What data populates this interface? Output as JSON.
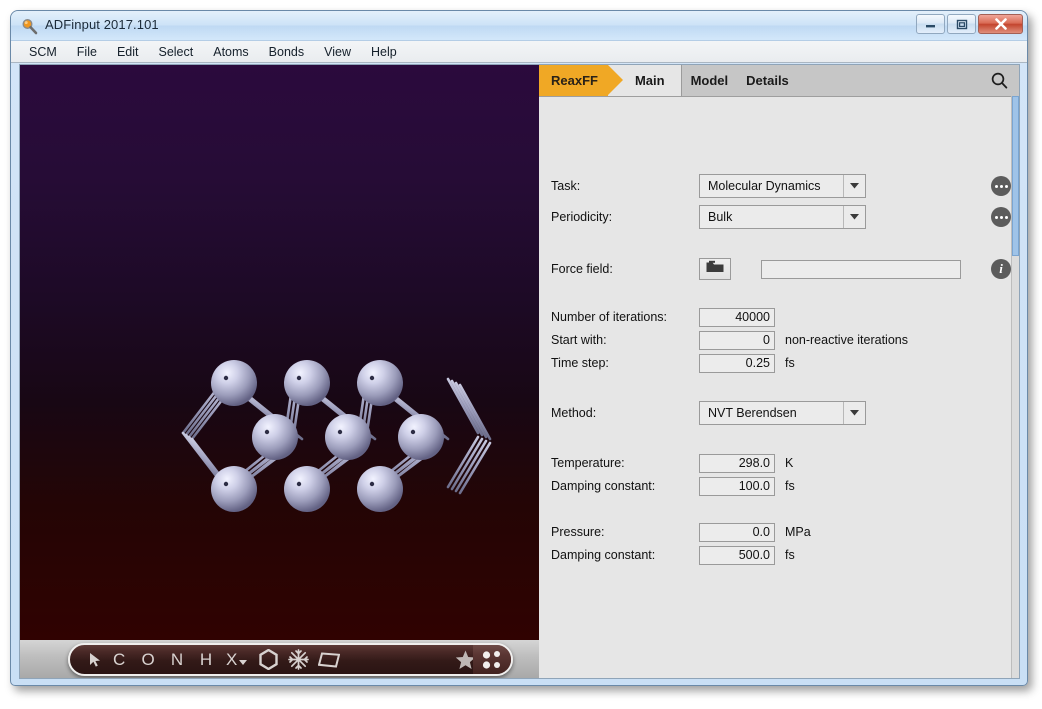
{
  "window": {
    "title": "ADFinput 2017.101",
    "icon": "magnifier-icon",
    "minimize_label": "Minimize",
    "maximize_label": "Maximize",
    "close_label": "Close"
  },
  "menubar": {
    "items": [
      {
        "label": "SCM"
      },
      {
        "label": "File"
      },
      {
        "label": "Edit"
      },
      {
        "label": "Select"
      },
      {
        "label": "Atoms"
      },
      {
        "label": "Bonds"
      },
      {
        "label": "View"
      },
      {
        "label": "Help"
      }
    ]
  },
  "tabs": {
    "module": "ReaxFF",
    "items": [
      {
        "label": "Main",
        "active": true
      },
      {
        "label": "Model",
        "active": false
      },
      {
        "label": "Details",
        "active": false
      }
    ],
    "search_icon": "search-icon"
  },
  "form": {
    "task": {
      "label": "Task:",
      "value": "Molecular Dynamics",
      "options": [
        "Molecular Dynamics"
      ],
      "more_icon": "ellipsis-icon"
    },
    "periodicity": {
      "label": "Periodicity:",
      "value": "Bulk",
      "options": [
        "Bulk"
      ],
      "more_icon": "ellipsis-icon"
    },
    "force_field": {
      "label": "Force field:",
      "value": "",
      "browse_icon": "folder-icon",
      "info_icon": "info-icon"
    },
    "iterations": {
      "label": "Number of iterations:",
      "value": "40000",
      "unit": ""
    },
    "start_with": {
      "label": "Start with:",
      "value": "0",
      "unit": "non-reactive iterations"
    },
    "time_step": {
      "label": "Time step:",
      "value": "0.25",
      "unit": "fs"
    },
    "method": {
      "label": "Method:",
      "value": "NVT Berendsen",
      "options": [
        "NVT Berendsen"
      ]
    },
    "temperature": {
      "label": "Temperature:",
      "value": "298.0",
      "unit": "K"
    },
    "temp_damping": {
      "label": "Damping constant:",
      "value": "100.0",
      "unit": "fs"
    },
    "pressure": {
      "label": "Pressure:",
      "value": "0.0",
      "unit": "MPa"
    },
    "pressure_damping": {
      "label": "Damping constant:",
      "value": "500.0",
      "unit": "fs"
    }
  },
  "view_toolbar": {
    "items": [
      {
        "name": "select-arrow-icon",
        "glyph": "➤",
        "kind": "icon"
      },
      {
        "name": "atom-c-button",
        "glyph": "C",
        "kind": "letter"
      },
      {
        "name": "atom-o-button",
        "glyph": "O",
        "kind": "letter"
      },
      {
        "name": "atom-n-button",
        "glyph": "N",
        "kind": "letter"
      },
      {
        "name": "atom-h-button",
        "glyph": "H",
        "kind": "letter"
      },
      {
        "name": "atom-x-dropdown",
        "glyph": "X",
        "kind": "letter-caret"
      },
      {
        "name": "benzene-ring-icon",
        "glyph": "⬡",
        "kind": "icon"
      },
      {
        "name": "snowflake-icon",
        "glyph": "❄",
        "kind": "icon"
      },
      {
        "name": "plane-icon",
        "glyph": "▱",
        "kind": "icon"
      },
      {
        "name": "star-icon",
        "glyph": "★",
        "kind": "icon"
      },
      {
        "name": "lattice-box-icon",
        "glyph": "⧉",
        "kind": "icon"
      },
      {
        "name": "atoms-grid-icon",
        "glyph": "",
        "kind": "dots"
      }
    ]
  },
  "scene": {
    "background_top": "#2b0a3d",
    "background_bottom": "#330000",
    "atom_color": "#b9bad6",
    "bond_color": "#9a9bb8",
    "description": "periodic crystal lattice of grey atoms with bonds"
  }
}
